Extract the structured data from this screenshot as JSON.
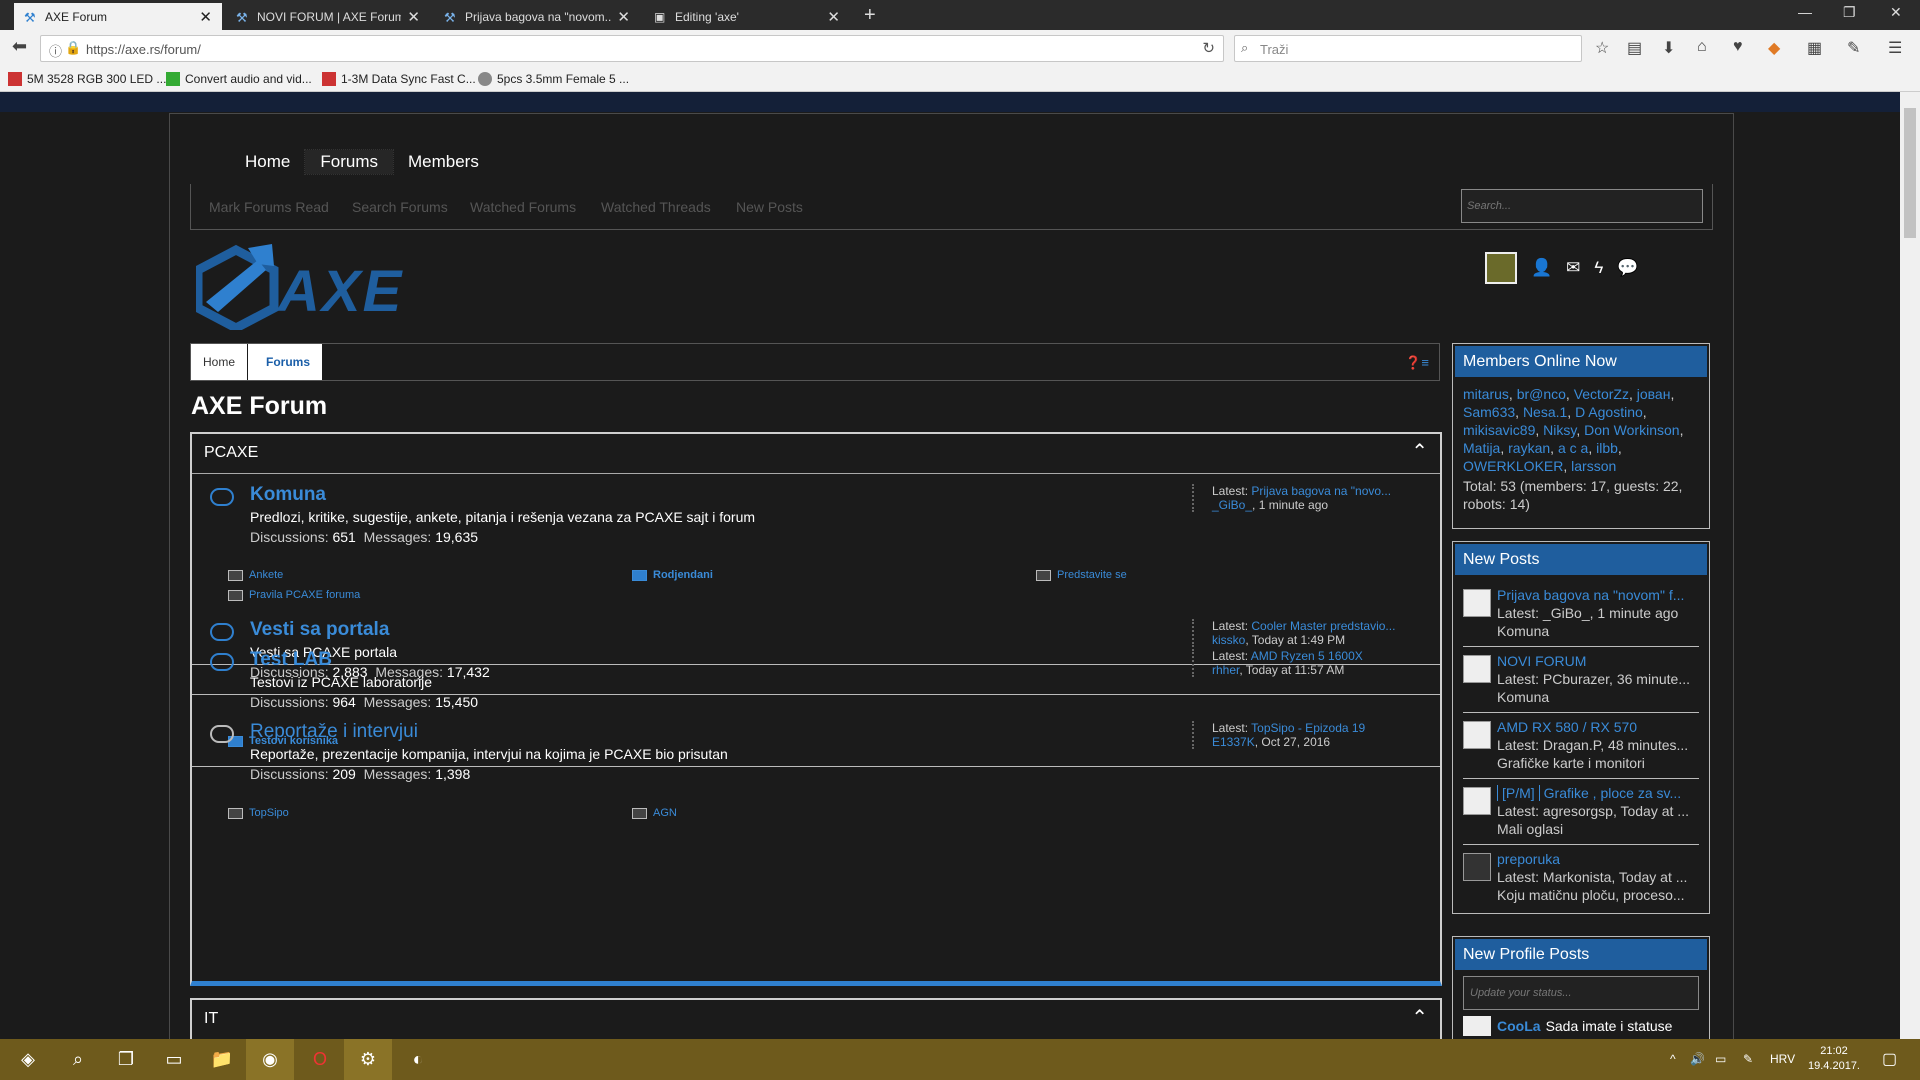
{
  "browser": {
    "tabs": [
      {
        "title": "AXE Forum",
        "active": true
      },
      {
        "title": "NOVI FORUM | AXE Forum",
        "active": false
      },
      {
        "title": "Prijava bagova na \"novom...",
        "active": false
      },
      {
        "title": "Editing 'axe'",
        "active": false
      }
    ],
    "new_tab": "+",
    "close": "✕",
    "url": "https://axe.rs/forum/",
    "search_placeholder": "Traži",
    "bookmarks": [
      "5M 3528 RGB 300 LED ...",
      "Convert audio and vid...",
      "1-3M Data Sync Fast C...",
      "5pcs 3.5mm Female 5 ..."
    ]
  },
  "site": {
    "nav": [
      "Home",
      "Forums",
      "Members"
    ],
    "subnav": [
      "Mark Forums Read",
      "Search Forums",
      "Watched Forums",
      "Watched Threads",
      "New Posts"
    ],
    "search_placeholder": "Search...",
    "logo_text": "AXE",
    "breadcrumb": [
      "Home",
      "Forums"
    ],
    "page_title": "AXE Forum"
  },
  "categories": [
    {
      "title": "PCAXE",
      "forums": [
        {
          "name": "Komuna",
          "desc": "Predlozi, kritike, sugestije, ankete, pitanja i rešenja vezana za PCAXE sajt i forum",
          "discussions_label": "Discussions:",
          "discussions": "651",
          "messages_label": "Messages:",
          "messages": "19,635",
          "latest_label": "Latest:",
          "latest_title": "Prijava bagova na \"novo...",
          "latest_user": "_GiBo_",
          "latest_time": ", 1 minute ago",
          "subforums": [
            "Ankete",
            "Rodjendani",
            "Predstavite se",
            "Pravila PCAXE foruma"
          ]
        },
        {
          "name": "Vesti sa portala",
          "desc": "Vesti sa PCAXE portala",
          "discussions_label": "Discussions:",
          "discussions": "2,883",
          "messages_label": "Messages:",
          "messages": "17,432",
          "latest_label": "Latest:",
          "latest_title": "Cooler Master predstavio...",
          "latest_user": "kissko",
          "latest_time": ", Today at 1:49 PM"
        },
        {
          "name": "Test LAB",
          "desc": "Testovi iz PCAXE laboratorije",
          "discussions_label": "Discussions:",
          "discussions": "964",
          "messages_label": "Messages:",
          "messages": "15,450",
          "latest_label": "Latest:",
          "latest_title": "AMD Ryzen 5 1600X",
          "latest_user": "rhher",
          "latest_time": ", Today at 11:57 AM",
          "subforums": [
            "Testovi korisnika"
          ]
        },
        {
          "name": "Reportaže i intervjui",
          "desc": "Reportaže, prezentacije kompanija, intervjui na kojima je PCAXE bio prisutan",
          "discussions_label": "Discussions:",
          "discussions": "209",
          "messages_label": "Messages:",
          "messages": "1,398",
          "latest_label": "Latest:",
          "latest_title": "TopSipo - Epizoda 19",
          "latest_user": "E1337K",
          "latest_time": ", Oct 27, 2016",
          "subforums": [
            "TopSipo",
            "AGN"
          ]
        }
      ]
    },
    {
      "title": "IT"
    }
  ],
  "sidebar": {
    "online": {
      "title": "Members Online Now",
      "members": [
        "mitarus",
        "br@nco",
        "VectorZz",
        "јован",
        "Sam633",
        "Nesa.1",
        "D Agostino",
        "mikisavic89",
        "Niksy",
        "Don Workinson",
        "Matija",
        "raykan",
        "a c a",
        "ilbb",
        "OWERKLOKER",
        "larsson"
      ],
      "total": "Total: 53 (members: 17, guests: 22, robots: 14)"
    },
    "new_posts": {
      "title": "New Posts",
      "items": [
        {
          "title": "Prijava bagova na \"novom\" f...",
          "latest": "Latest: _GiBo_, 1 minute ago",
          "forum": "Komuna"
        },
        {
          "title": "NOVI FORUM",
          "latest": "Latest: PCburazer, 36 minute...",
          "forum": "Komuna"
        },
        {
          "title": "AMD RX 580 / RX 570",
          "latest": "Latest: Dragan.P, 48 minutes...",
          "forum": "Grafičke karte i monitori"
        },
        {
          "tag": "[P/M]",
          "title": "Grafike , ploce za sv...",
          "latest": "Latest: agresorgsp, Today at ...",
          "forum": "Mali oglasi"
        },
        {
          "title": "preporuka",
          "latest": "Latest: Markonista, Today at ...",
          "forum": "Koju matičnu ploču, proceso..."
        }
      ]
    },
    "profile_posts": {
      "title": "New Profile Posts",
      "placeholder": "Update your status...",
      "first_user": "CooLa",
      "first_text": "Sada imate i statuse"
    }
  },
  "taskbar": {
    "lang": "HRV",
    "time": "21:02",
    "date": "19.4.2017."
  },
  "colors": {
    "accent": "#3a8bd8",
    "header_blue": "#1f5e9e",
    "taskbar": "#6e5a1c"
  }
}
